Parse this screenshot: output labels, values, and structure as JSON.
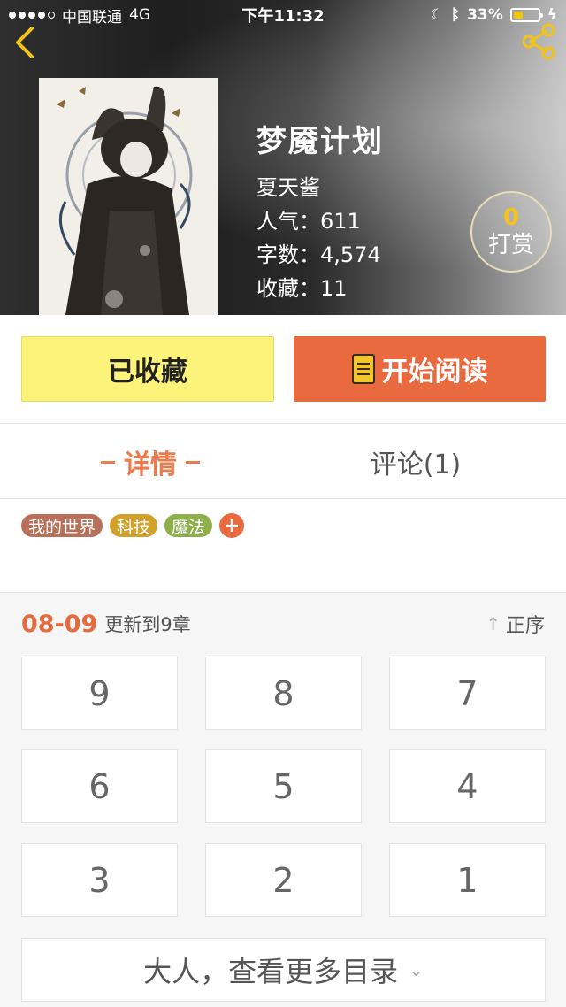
{
  "status_bar": {
    "carrier": "中国联通",
    "network": "4G",
    "time": "下午11:32",
    "battery": "33%",
    "battery_level": 0.33
  },
  "nav": {
    "back_icon": "back-arrow-icon",
    "share_icon": "share-icon"
  },
  "book": {
    "title": "梦魇计划",
    "author": "夏天酱",
    "popularity": "人气：611",
    "word_count": "字数：4,574",
    "favorites": "收藏：11"
  },
  "tip": {
    "count": "0",
    "label": "打赏"
  },
  "actions": {
    "favorite_label": "已收藏",
    "read_label": "开始阅读"
  },
  "tabs": {
    "detail": "详情",
    "comments": "评论(1)"
  },
  "tags": [
    {
      "label": "我的世界",
      "color": "#b9705a"
    },
    {
      "label": "科技",
      "color": "#d1a12c"
    },
    {
      "label": "魔法",
      "color": "#8fae4c"
    }
  ],
  "tag_add": "+",
  "colors": {
    "accent": "#ea6a40",
    "favorite_bg": "#fcf37a"
  },
  "chapters": {
    "date": "08-09",
    "update_text": "更新到9章",
    "sort_label": "正序",
    "items": [
      "9",
      "8",
      "7",
      "6",
      "5",
      "4",
      "3",
      "2",
      "1"
    ],
    "more_label": "大人，查看更多目录"
  }
}
